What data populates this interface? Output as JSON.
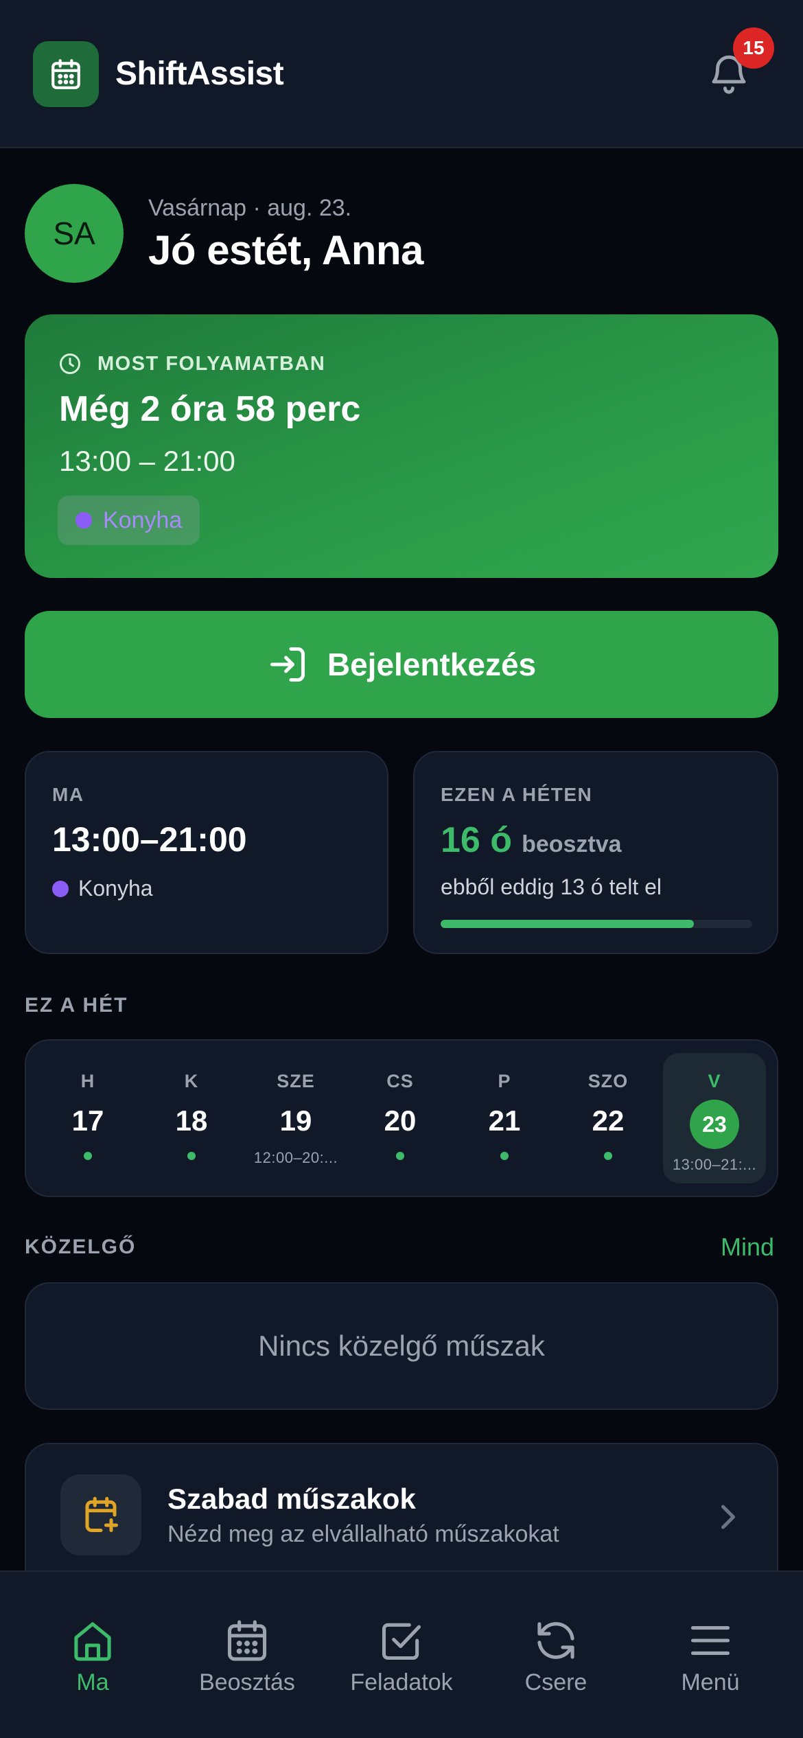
{
  "header": {
    "app_title": "ShiftAssist",
    "notification_count": "15"
  },
  "greeting": {
    "avatar_initials": "SA",
    "date_line": "Vasárnap · aug. 23.",
    "text": "Jó estét, Anna"
  },
  "current_shift": {
    "label": "MOST FOLYAMATBAN",
    "remaining": "Még 2 óra 58 perc",
    "time_range": "13:00 – 21:00",
    "location": "Konyha",
    "location_color": "#8b5cf6"
  },
  "checkin": {
    "label": "Bejelentkezés"
  },
  "today": {
    "label": "MA",
    "time": "13:00–21:00",
    "location": "Konyha"
  },
  "this_week": {
    "label": "EZEN A HÉTEN",
    "hours": "16 ó",
    "hours_suffix": "beosztva",
    "elapsed": "ebből eddig 13 ó telt el",
    "progress_fraction": 0.8125
  },
  "week": {
    "section_label": "EZ A HÉT",
    "days": [
      {
        "name": "H",
        "num": "17",
        "dot": true,
        "time": ""
      },
      {
        "name": "K",
        "num": "18",
        "dot": true,
        "time": ""
      },
      {
        "name": "SZE",
        "num": "19",
        "dot": false,
        "time": "12:00–20:..."
      },
      {
        "name": "CS",
        "num": "20",
        "dot": true,
        "time": ""
      },
      {
        "name": "P",
        "num": "21",
        "dot": true,
        "time": ""
      },
      {
        "name": "SZO",
        "num": "22",
        "dot": true,
        "time": ""
      },
      {
        "name": "V",
        "num": "23",
        "dot": false,
        "time": "13:00–21:..."
      }
    ]
  },
  "upcoming": {
    "section_label": "KÖZELGŐ",
    "all_link": "Mind",
    "empty_text": "Nincs közelgő műszak"
  },
  "open_shifts": {
    "title": "Szabad műszakok",
    "subtitle": "Nézd meg az elvállalható műszakokat"
  },
  "nav": {
    "items": [
      {
        "label": "Ma",
        "icon": "home-icon",
        "active": true
      },
      {
        "label": "Beosztás",
        "icon": "calendar-icon",
        "active": false
      },
      {
        "label": "Feladatok",
        "icon": "checkbox-icon",
        "active": false
      },
      {
        "label": "Csere",
        "icon": "swap-icon",
        "active": false
      },
      {
        "label": "Menü",
        "icon": "menu-icon",
        "active": false
      }
    ]
  },
  "colors": {
    "accent": "#2fa44a",
    "accent_text": "#3dbb6a",
    "badge": "#dc2626",
    "background": "#05080f",
    "card": "#111827"
  }
}
